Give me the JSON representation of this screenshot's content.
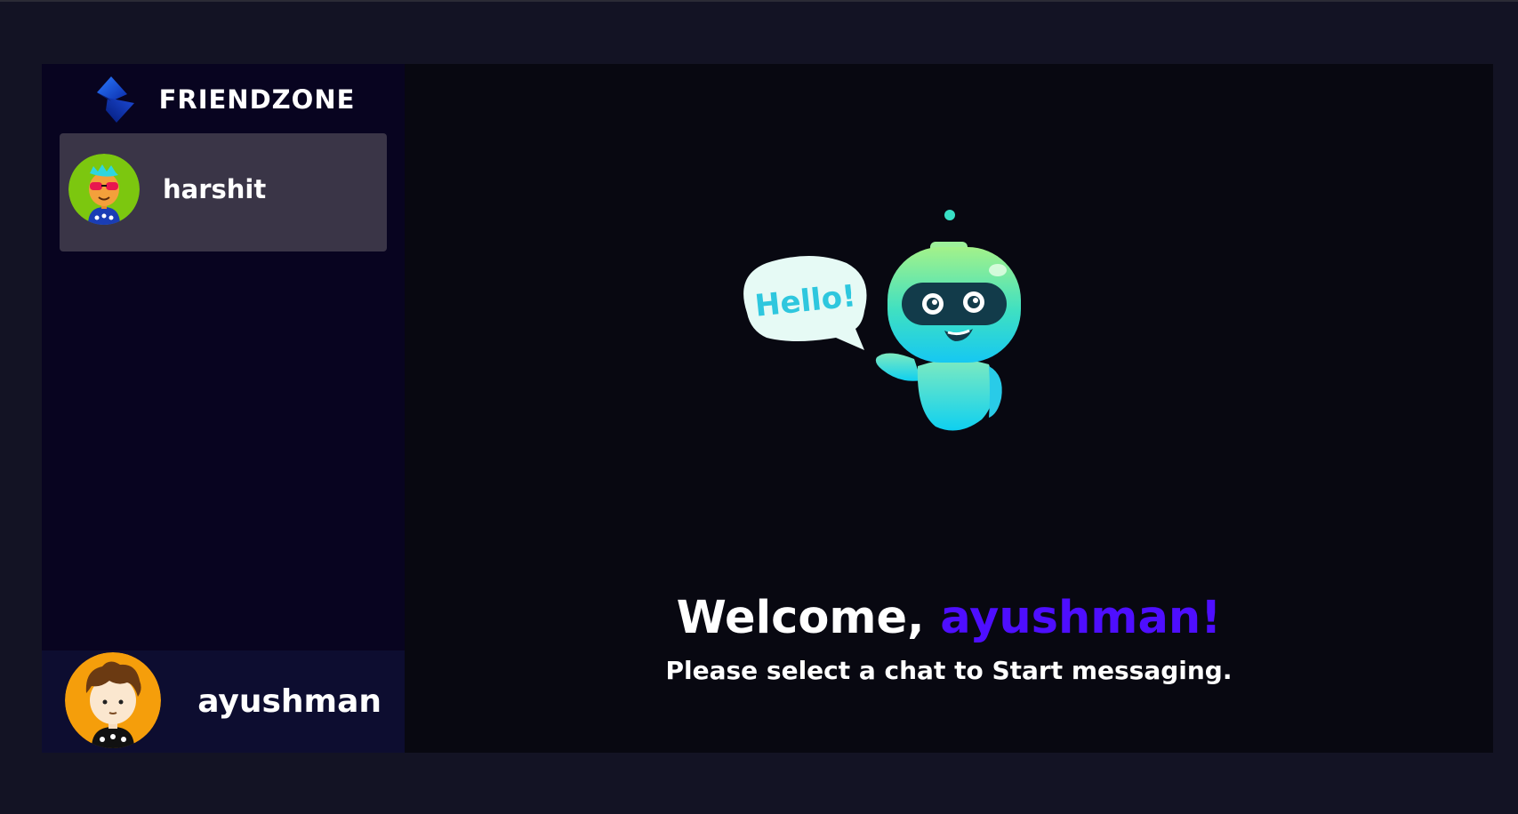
{
  "brand": {
    "name": "FRIENDZONE",
    "logo_icon": "brand-logo-icon"
  },
  "contacts": [
    {
      "name": "harshit",
      "avatar_icon": "avatar-harshit-icon",
      "selected": true
    }
  ],
  "current_user": {
    "name": "ayushman",
    "avatar_icon": "avatar-ayushman-icon"
  },
  "welcome": {
    "prefix": "Welcome,",
    "username": "ayushman!",
    "subtitle": "Please select a chat to Start messaging."
  },
  "illustration": {
    "bubble_text": "Hello!",
    "icon": "robot-icon"
  },
  "colors": {
    "background": "#131324",
    "sidebar": "#080420",
    "selected_contact": "#3a3547",
    "user_bar": "#0d0d30",
    "accent": "#4e0eff"
  }
}
